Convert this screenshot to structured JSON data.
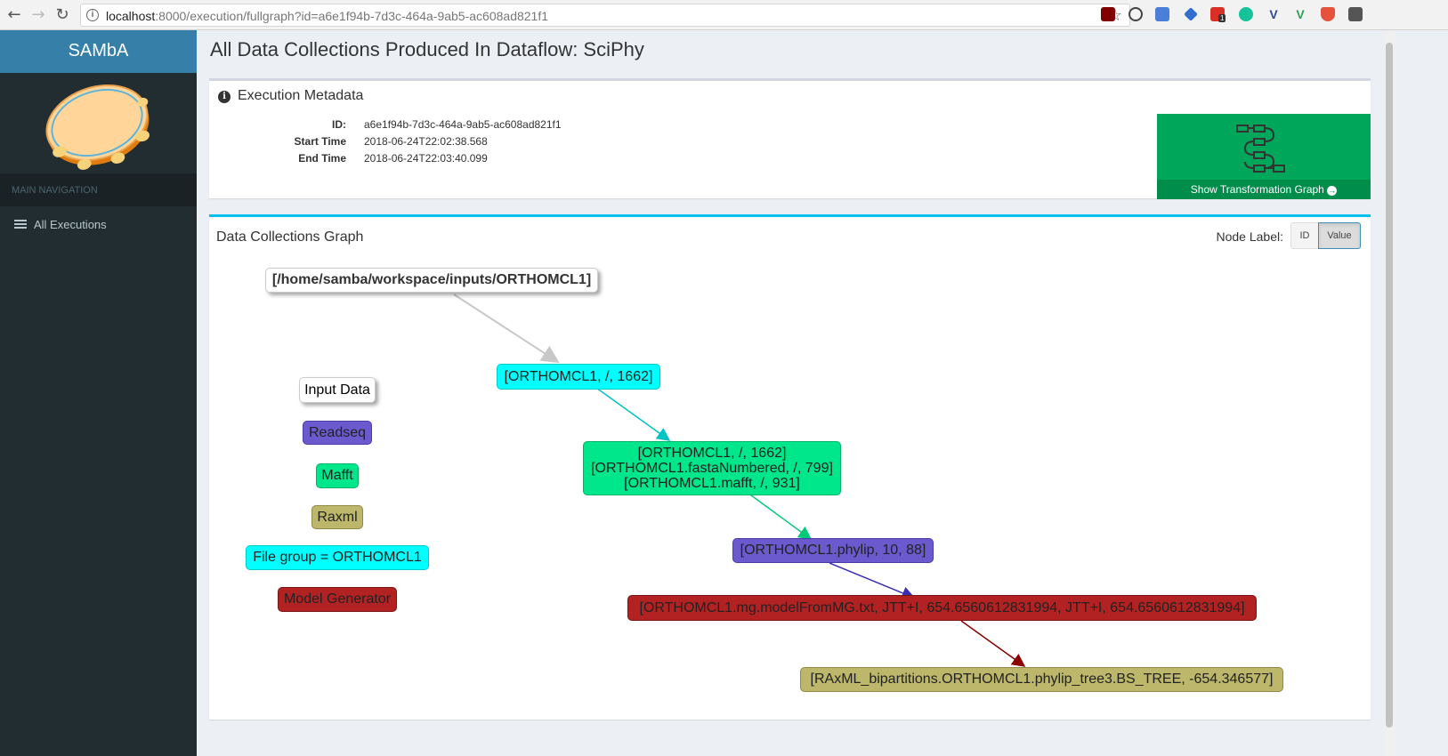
{
  "browser": {
    "url_host": "localhost",
    "url_rest": ":8000/execution/fullgraph?id=a6e1f94b-7d3c-464a-9ab5-ac608ad821f1",
    "ext_badge": "1"
  },
  "sidebar": {
    "brand": "SAMbA",
    "nav_header": "MAIN NAVIGATION",
    "items": [
      {
        "label": "All Executions",
        "icon": "list-icon"
      }
    ]
  },
  "page": {
    "title": "All Data Collections Produced In Dataflow: SciPhy"
  },
  "metadata": {
    "header": "Execution Metadata",
    "id_label": "ID:",
    "id_value": "a6e1f94b-7d3c-464a-9ab5-ac608ad821f1",
    "start_label": "Start Time",
    "start_value": "2018-06-24T22:02:38.568",
    "end_label": "End Time",
    "end_value": "2018-06-24T22:03:40.099",
    "transform_button": "Show Transformation Graph"
  },
  "graph": {
    "title": "Data Collections Graph",
    "node_label_text": "Node Label:",
    "btn_id": "ID",
    "btn_value": "Value",
    "legend": [
      {
        "label": "Input Data",
        "color": "#ffffff"
      },
      {
        "label": "Readseq",
        "color": "#6a5acd"
      },
      {
        "label": "Mafft",
        "color": "#00e68a"
      },
      {
        "label": "Raxml",
        "color": "#bdb76b"
      },
      {
        "label": "File group = ORTHOMCL1",
        "color": "#00ffff"
      },
      {
        "label": "Model Generator",
        "color": "#b22222"
      }
    ],
    "nodes": {
      "input": "[/home/samba/workspace/inputs/ORTHOMCL1]",
      "n1": "[ORTHOMCL1, /, 1662]",
      "n2_l1": "[ORTHOMCL1, /, 1662]",
      "n2_l2": "[ORTHOMCL1.fastaNumbered, /, 799]",
      "n2_l3": "[ORTHOMCL1.mafft, /, 931]",
      "n3": "[ORTHOMCL1.phylip, 10, 88]",
      "n4": "[ORTHOMCL1.mg.modelFromMG.txt, JTT+I, 654.6560612831994, JTT+I, 654.6560612831994]",
      "n5": "[RAxML_bipartitions.ORTHOMCL1.phylip_tree3.BS_TREE, -654.346577]"
    }
  }
}
